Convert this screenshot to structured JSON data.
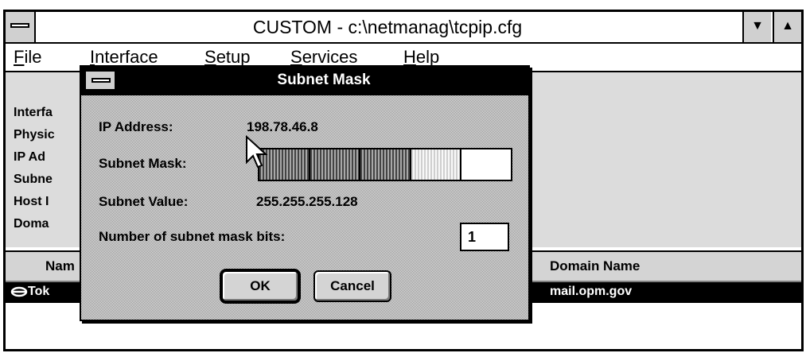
{
  "window": {
    "title": "CUSTOM - c:\\netmanag\\tcpip.cfg",
    "min_glyph": "▼",
    "max_glyph": "▲"
  },
  "menubar": [
    "File",
    "Interface",
    "Setup",
    "Services",
    "Help"
  ],
  "background_fields": [
    "Interfa",
    "Physic",
    "IP Ad",
    "Subne",
    "Host I",
    "Doma"
  ],
  "table": {
    "columns": [
      "Nam",
      "Domain Name"
    ],
    "row": {
      "name": "Tok",
      "domain": "mail.opm.gov"
    }
  },
  "dialog": {
    "title": "Subnet Mask",
    "ip_label": "IP Address:",
    "ip_value": "198.78.46.8",
    "mask_label": "Subnet Mask:",
    "mask_segments": [
      "full",
      "full",
      "full",
      "partial",
      "empty"
    ],
    "value_label": "Subnet Value:",
    "value": "255.255.255.128",
    "bits_label": "Number of subnet mask bits:",
    "bits_value": "1",
    "ok_label": "OK",
    "cancel_label": "Cancel"
  },
  "icons": [
    "system-menu-icon",
    "minimize-icon",
    "maximize-icon",
    "link-icon",
    "arrow-cursor-icon"
  ]
}
